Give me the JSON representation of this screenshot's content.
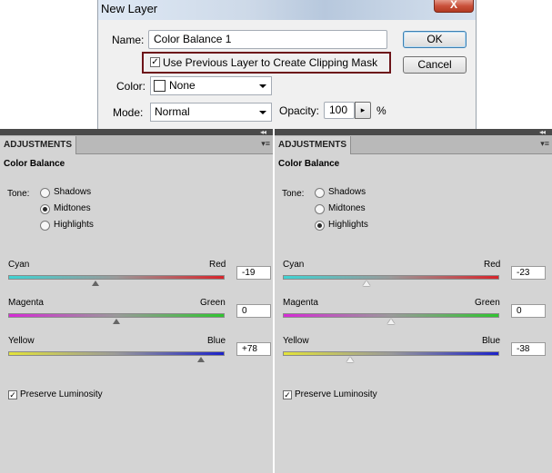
{
  "dialog": {
    "title": "New Layer",
    "close_label": "X",
    "name_label": "Name:",
    "name_value": "Color Balance 1",
    "clipping_label": "Use Previous Layer to Create Clipping Mask",
    "clipping_checked": true,
    "color_label": "Color:",
    "color_value": "None",
    "mode_label": "Mode:",
    "mode_value": "Normal",
    "opacity_label": "Opacity:",
    "opacity_value": "100",
    "percent": "%",
    "ok_label": "OK",
    "cancel_label": "Cancel"
  },
  "panels": [
    {
      "tab": "ADJUSTMENTS",
      "heading": "Color Balance",
      "tone_label": "Tone:",
      "tones": [
        "Shadows",
        "Midtones",
        "Highlights"
      ],
      "selected_tone": "Midtones",
      "sliders": [
        {
          "left": "Cyan",
          "right": "Red",
          "value": "-19",
          "level": -19
        },
        {
          "left": "Magenta",
          "right": "Green",
          "value": "0",
          "level": 0
        },
        {
          "left": "Yellow",
          "right": "Blue",
          "value": "+78",
          "level": 78
        }
      ],
      "preserve_label": "Preserve Luminosity",
      "preserve_checked": true
    },
    {
      "tab": "ADJUSTMENTS",
      "heading": "Color Balance",
      "tone_label": "Tone:",
      "tones": [
        "Shadows",
        "Midtones",
        "Highlights"
      ],
      "selected_tone": "Highlights",
      "sliders": [
        {
          "left": "Cyan",
          "right": "Red",
          "value": "-23",
          "level": -23
        },
        {
          "left": "Magenta",
          "right": "Green",
          "value": "0",
          "level": 0
        },
        {
          "left": "Yellow",
          "right": "Blue",
          "value": "-38",
          "level": -38
        }
      ],
      "preserve_label": "Preserve Luminosity",
      "preserve_checked": true
    }
  ],
  "colors": {
    "cyan": "#3fd3d3",
    "red": "#d8232a",
    "magenta": "#d62ad6",
    "green": "#2fc52f",
    "yellow": "#e3e33a",
    "blue": "#1c22c9",
    "clip_highlight": "#6d1419"
  },
  "icons": {
    "checkmark": "✓",
    "collapse": "◂◂",
    "stepper_arrow": "▸",
    "panel_menu": "▾≡"
  }
}
